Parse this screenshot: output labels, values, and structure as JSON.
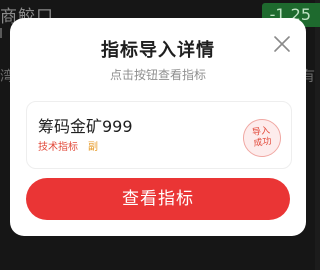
{
  "background": {
    "title": "商鲛口",
    "badge": "-1.25",
    "left_hint": "湾",
    "right_hint": "有"
  },
  "modal": {
    "title": "指标导入详情",
    "subtitle": "点击按钮查看指标",
    "close_icon": "close-icon",
    "indicator": {
      "name": "筹码金矿999",
      "tags": [
        "技术指标",
        "副"
      ],
      "stamp_line1": "导入",
      "stamp_line2": "成功"
    },
    "primary_button": "查看指标"
  },
  "colors": {
    "accent": "#ea3535",
    "tag_red": "#e24a3b",
    "tag_orange": "#e79a28",
    "badge_green": "#1e6a2e"
  }
}
